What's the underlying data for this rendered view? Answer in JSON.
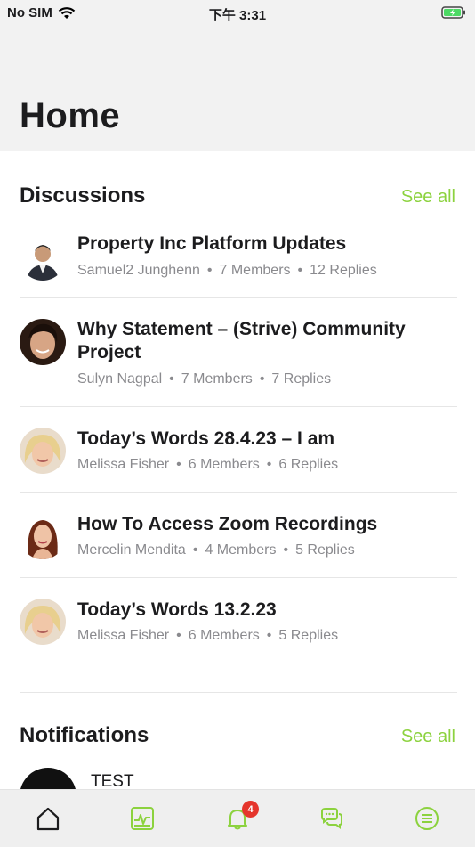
{
  "status": {
    "carrier": "No SIM",
    "time": "下午 3:31"
  },
  "page": {
    "title": "Home"
  },
  "discussions": {
    "heading": "Discussions",
    "see_all": "See all",
    "items": [
      {
        "title": "Property Inc Platform Updates",
        "author": "Samuel2 Junghenn",
        "members": "7 Members",
        "replies": "12 Replies"
      },
      {
        "title": "Why Statement – (Strive) Community Project",
        "author": "Sulyn Nagpal",
        "members": "7 Members",
        "replies": "7 Replies"
      },
      {
        "title": "Today’s Words 28.4.23 – I am",
        "author": "Melissa Fisher",
        "members": "6 Members",
        "replies": "6 Replies"
      },
      {
        "title": "How To Access Zoom Recordings",
        "author": "Mercelin Mendita",
        "members": "4 Members",
        "replies": "5 Replies"
      },
      {
        "title": "Today’s Words 13.2.23",
        "author": "Melissa Fisher",
        "members": "6 Members",
        "replies": "5 Replies"
      }
    ]
  },
  "notifications": {
    "heading": "Notifications",
    "see_all": "See all",
    "first_title": "TEST"
  },
  "tabbar": {
    "notifications_badge": "4"
  },
  "colors": {
    "accent": "#8cd23e",
    "badge": "#e5352c"
  }
}
